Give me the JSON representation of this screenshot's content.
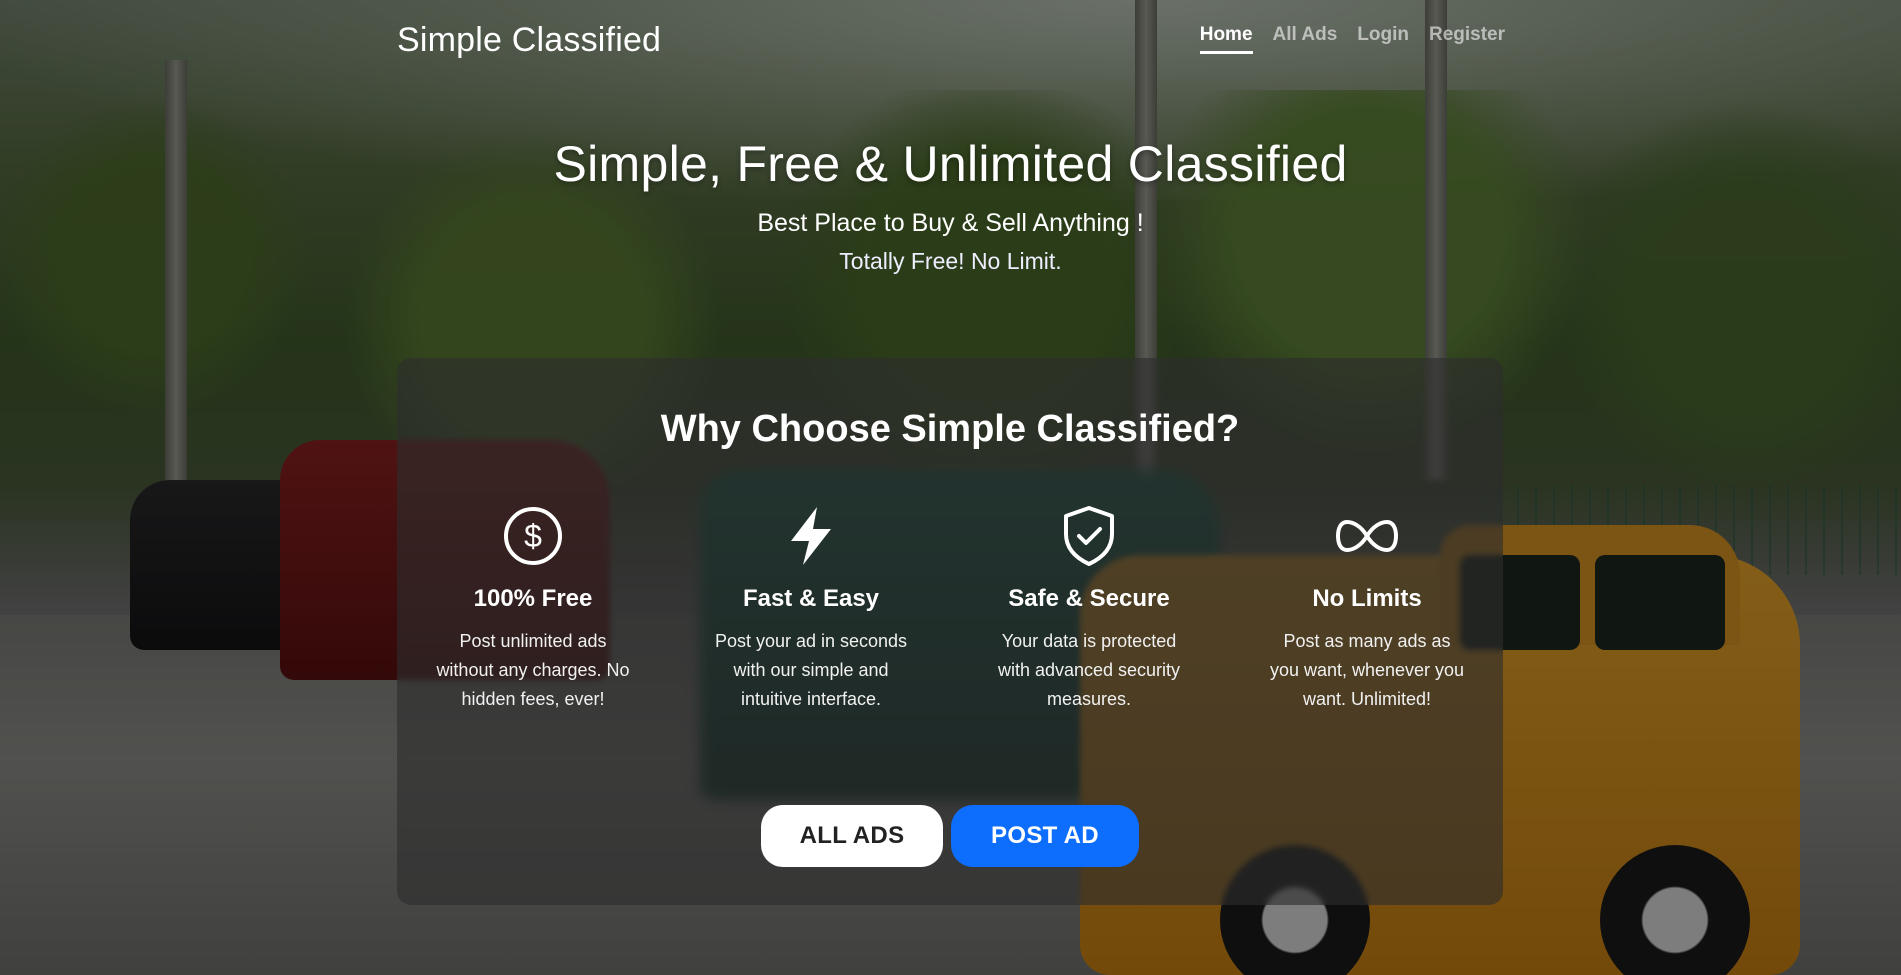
{
  "navbar": {
    "brand": "Simple Classified",
    "links": [
      {
        "label": "Home",
        "active": true
      },
      {
        "label": "All Ads",
        "active": false
      },
      {
        "label": "Login",
        "active": false
      },
      {
        "label": "Register",
        "active": false
      }
    ]
  },
  "hero": {
    "title": "Simple, Free & Unlimited Classified",
    "subtitle": "Best Place to Buy & Sell Anything !",
    "tagline": "Totally Free! No Limit."
  },
  "why": {
    "title": "Why Choose Simple Classified?",
    "features": [
      {
        "icon": "dollar-circle-icon",
        "title": "100% Free",
        "text": "Post unlimited ads without any charges. No hidden fees, ever!"
      },
      {
        "icon": "lightning-icon",
        "title": "Fast & Easy",
        "text": "Post your ad in seconds with our simple and intuitive interface."
      },
      {
        "icon": "shield-check-icon",
        "title": "Safe & Secure",
        "text": "Your data is protected with advanced security measures."
      },
      {
        "icon": "infinity-icon",
        "title": "No Limits",
        "text": "Post as many ads as you want, whenever you want. Unlimited!"
      }
    ],
    "buttons": {
      "all_ads": "ALL ADS",
      "post_ad": "POST AD"
    }
  },
  "colors": {
    "primary": "#0d6efd",
    "panel": "rgba(45,45,45,0.62)"
  }
}
